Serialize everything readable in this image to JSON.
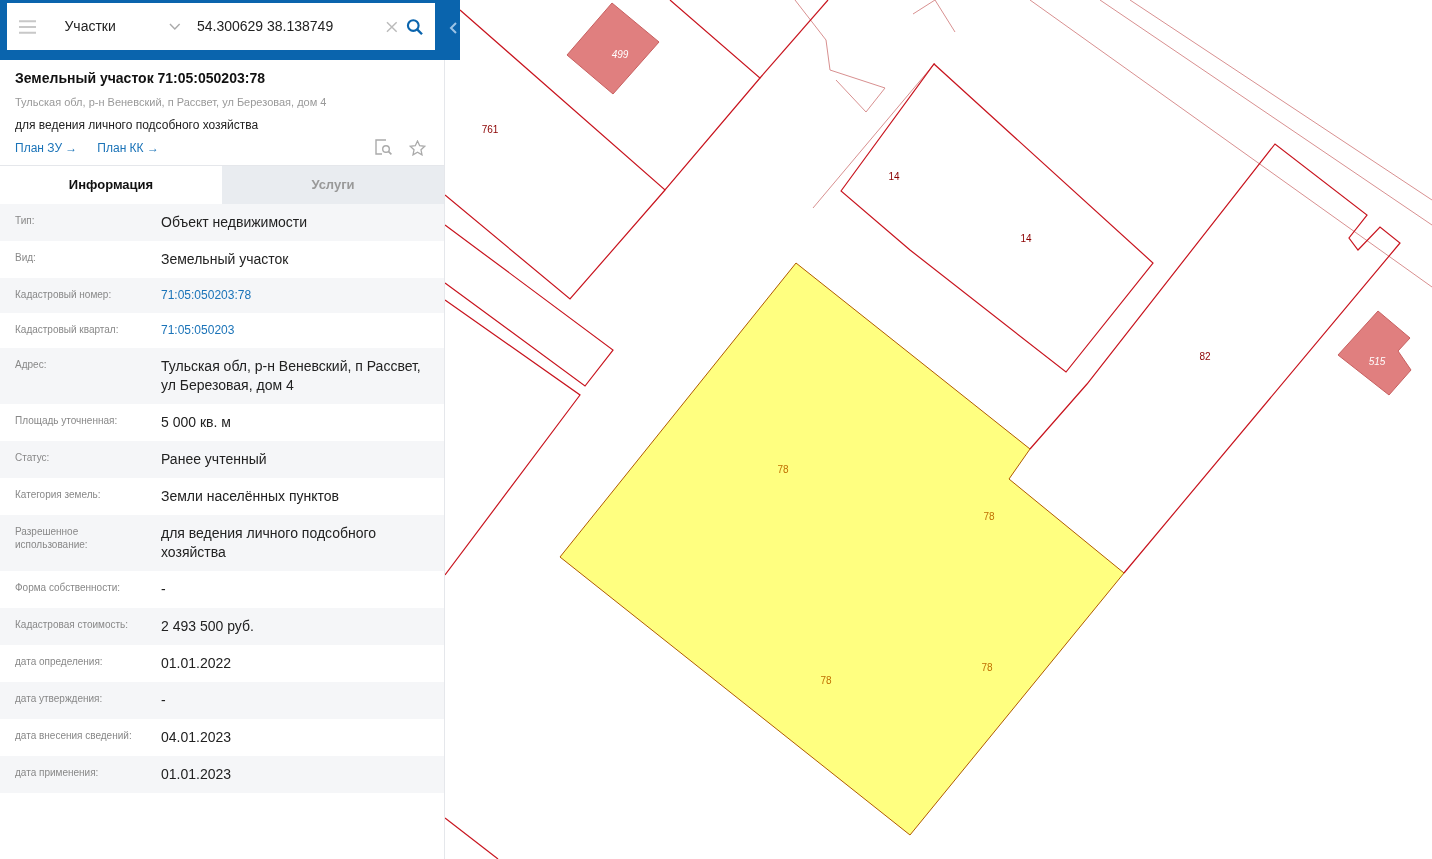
{
  "search": {
    "layer": "Участки",
    "query": "54.300629 38.138749"
  },
  "card": {
    "title": "Земельный участок 71:05:050203:78",
    "address": "Тульская обл, р-н Веневский, п Рассвет, ул Березовая, дом 4",
    "purpose": "для ведения личного подсобного хозяйства",
    "links": [
      "План ЗУ →",
      "План КК →"
    ]
  },
  "tabs": [
    {
      "label": "Информация",
      "selected": true
    },
    {
      "label": "Услуги",
      "selected": false
    }
  ],
  "rows": [
    {
      "label": "Тип:",
      "value": "Объект недвижимости",
      "kind": "text"
    },
    {
      "label": "Вид:",
      "value": "Земельный участок",
      "kind": "text"
    },
    {
      "label": "Кадастровый номер:",
      "value": "71:05:050203:78",
      "kind": "link"
    },
    {
      "label": "Кадастровый квартал:",
      "value": "71:05:050203",
      "kind": "link"
    },
    {
      "label": "Адрес:",
      "value": "Тульская обл, р-н Веневский, п Рассвет, ул Березовая, дом 4",
      "kind": "text"
    },
    {
      "label": "Площадь уточненная:",
      "value": "5 000 кв. м",
      "kind": "text"
    },
    {
      "label": "Статус:",
      "value": "Ранее учтенный",
      "kind": "text"
    },
    {
      "label": "Категория земель:",
      "value": "Земли населённых пунктов",
      "kind": "text"
    },
    {
      "label": "Разрешенное использование:",
      "value": "для ведения личного подсобного хозяйства",
      "kind": "text"
    },
    {
      "label": "Форма собственности:",
      "value": "-",
      "kind": "text"
    },
    {
      "label": "Кадастровая стоимость:",
      "value": "2 493 500 руб.",
      "kind": "text"
    },
    {
      "label": "дата определения:",
      "value": "01.01.2022",
      "kind": "text"
    },
    {
      "label": "дата утверждения:",
      "value": "-",
      "kind": "text"
    },
    {
      "label": "дата внесения сведений:",
      "value": "04.01.2023",
      "kind": "text"
    },
    {
      "label": "дата применения:",
      "value": "01.01.2023",
      "kind": "text"
    }
  ],
  "map": {
    "labels": [
      {
        "text": "761",
        "kind": "parcel"
      },
      {
        "text": "499",
        "kind": "building"
      },
      {
        "text": "14",
        "kind": "parcel"
      },
      {
        "text": "14",
        "kind": "parcel"
      },
      {
        "text": "82",
        "kind": "parcel"
      },
      {
        "text": "515",
        "kind": "building"
      },
      {
        "text": "78",
        "kind": "selected"
      },
      {
        "text": "78",
        "kind": "selected"
      },
      {
        "text": "78",
        "kind": "selected"
      },
      {
        "text": "78",
        "kind": "selected"
      }
    ]
  }
}
